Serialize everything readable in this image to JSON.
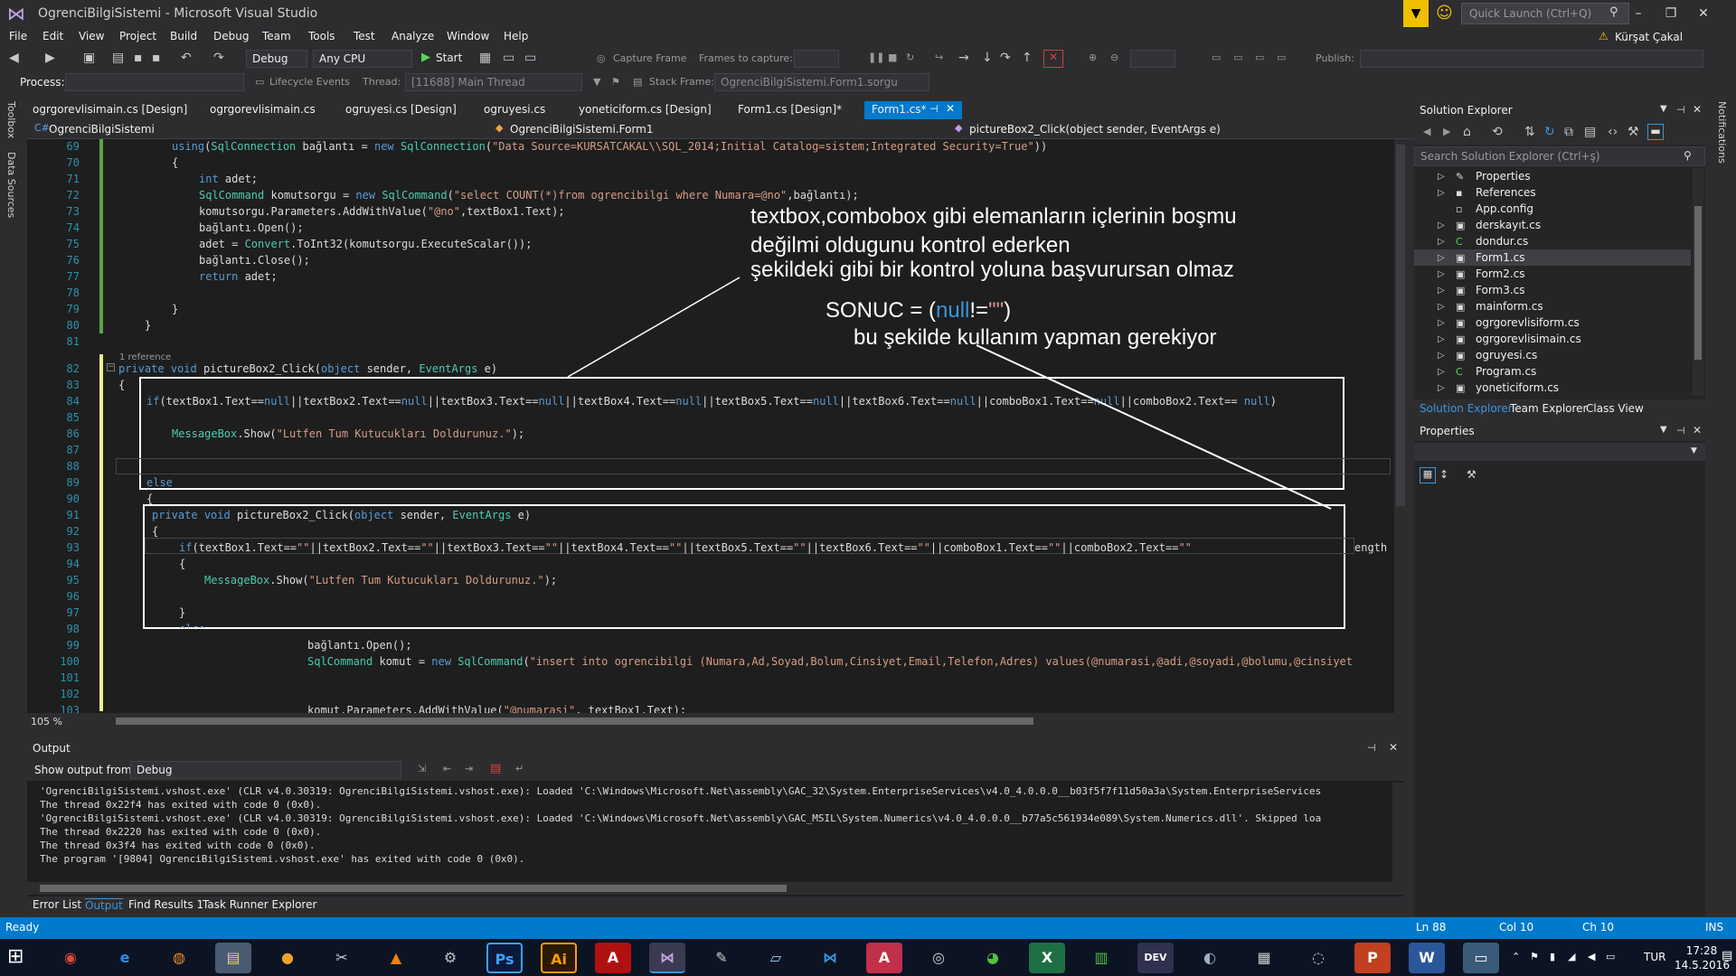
{
  "window": {
    "title": "OgrenciBilgiSistemi - Microsoft Visual Studio",
    "quick_launch": "Quick Launch (Ctrl+Q)",
    "user": "Kürşat Çakal"
  },
  "menu": [
    "File",
    "Edit",
    "View",
    "Project",
    "Build",
    "Debug",
    "Team",
    "Tools",
    "Test",
    "Analyze",
    "Window",
    "Help"
  ],
  "toolbar": {
    "config": "Debug",
    "platform": "Any CPU",
    "start": "Start",
    "capture": "Capture Frame",
    "frames_label": "Frames to capture:",
    "publish": "Publish:"
  },
  "toolbar2": {
    "process_label": "Process:",
    "lifecycle": "Lifecycle Events",
    "thread_label": "Thread:",
    "thread_value": "[11688] Main Thread",
    "stack_label": "Stack Frame:",
    "stack_value": "OgrenciBilgiSistemi.Form1.sorgu"
  },
  "side_tabs": [
    "Toolbox",
    "Data Sources"
  ],
  "right_tab": "Notifications",
  "doc_tabs": [
    "ogrgorevlisimain.cs [Design]",
    "ogrgorevlisimain.cs",
    "ogruyesi.cs [Design]",
    "ogruyesi.cs",
    "yoneticiform.cs [Design]",
    "Form1.cs [Design]*",
    "Form1.cs*"
  ],
  "navbar": {
    "project": "OgrenciBilgiSistemi",
    "class": "OgrenciBilgiSistemi.Form1",
    "member": "pictureBox2_Click(object sender, EventArgs e)"
  },
  "line_numbers": [
    "69",
    "70",
    "71",
    "72",
    "73",
    "74",
    "75",
    "76",
    "77",
    "78",
    "79",
    "80",
    "81",
    "82",
    "83",
    "84",
    "85",
    "86",
    "87",
    "88",
    "89",
    "90",
    "91",
    "92",
    "93",
    "94",
    "95",
    "96",
    "97",
    "98",
    "99",
    "100",
    "101",
    "102",
    "103"
  ],
  "code": {
    "l69a": "using",
    "l69b": "(",
    "l69c": "SqlConnection",
    "l69d": " bağlantı = ",
    "l69e": "new",
    "l69f": " ",
    "l69g": "SqlConnection",
    "l69h": "(",
    "l69i": "\"Data Source=KURSATCAKAL\\\\SQL_2014;Initial Catalog=sistem;Integrated Security=True\"",
    "l69j": "))",
    "l70": "{",
    "l71a": "int",
    "l71b": " adet;",
    "l72a": "SqlCommand",
    "l72b": " komutsorgu = ",
    "l72c": "new",
    "l72d": "SqlCommand",
    "l72e": "(",
    "l72f": "\"select COUNT(*)from ogrencibilgi where Numara=@no\"",
    "l72g": ",bağlantı);",
    "l73a": "komutsorgu.Parameters.AddWithValue(",
    "l73b": "\"@no\"",
    "l73c": ",textBox1.Text);",
    "l74": "bağlantı.Open();",
    "l75a": "adet = ",
    "l75b": "Convert",
    "l75c": ".ToInt32(komutsorgu.ExecuteScalar());",
    "l76": "bağlantı.Close();",
    "l77a": "return",
    "l77b": " adet;",
    "l79": "}",
    "l80": "}",
    "ref": "1 reference",
    "l82a": "private",
    "l82b": " ",
    "l82c": "void",
    "l82d": " pictureBox2_Click(",
    "l82e": "object",
    "l82f": " sender, ",
    "l82g": "EventArgs",
    "l82h": " e)",
    "l83": "{",
    "l84a": "if",
    "l84b": "(textBox1.Text==",
    "l84c": "null",
    "l84d": "||textBox2.Text==",
    "l84e": "null",
    "l84f": "||textBox3.Text==",
    "l84g": "null",
    "l84h": "||textBox4.Text==",
    "l84i": "null",
    "l84j": "||textBox5.Text==",
    "l84k": "null",
    "l84l": "||textBox6.Text==",
    "l84m": "null",
    "l84n": "||comboBox1.Text==",
    "l84o": "null",
    "l84p": "||comboBox2.Text== ",
    "l84q": "null",
    "l84r": ")",
    "l86a": "MessageBox",
    "l86b": ".Show(",
    "l86c": "\"Lutfen Tum Kutucukları Doldurunuz.\"",
    "l86d": ");",
    "l89": "else",
    "l90": "{",
    "l91a": "private",
    "l91b": " ",
    "l91c": "void",
    "l91d": " pictureBox2_Click(",
    "l91e": "object",
    "l91f": " sender, ",
    "l91g": "EventArgs",
    "l91h": " e)",
    "l92": "{",
    "l93a": "if",
    "l93b": "(textBox1.Text==",
    "l93c": "\"\"",
    "l93d": "||textBox2.Text==",
    "l93e": "\"\"",
    "l93f": "||textBox3.Text==",
    "l93g": "\"\"",
    "l93h": "||textBox4.Text==",
    "l93i": "\"\"",
    "l93j": "||textBox5.Text==",
    "l93k": "\"\"",
    "l93l": "||textBox6.Text==",
    "l93m": "\"\"",
    "l93n": "||comboBox1.Text==",
    "l93o": "\"\"",
    "l93p": "||comboBox2.Text==",
    "l93q": "\"\"",
    "l93tail": "ength",
    "l94": "{",
    "l95a": "MessageBox",
    "l95b": ".Show(",
    "l95c": "\"Lutfen Tum Kutucukları Doldurunuz.\"",
    "l95d": ");",
    "l97": "}",
    "l98": "else",
    "l99": "bağlantı.Open();",
    "l100a": "SqlCommand",
    "l100b": " komut = ",
    "l100c": "new",
    "l100d": "SqlCommand",
    "l100e": "(",
    "l100f": "\"insert into ogrencibilgi (Numara,Ad,Soyad,Bolum,Cinsiyet,Email,Telefon,Adres) values(@numarasi,@adi,@soyadi,@bolumu,@cinsiyet",
    "l103a": "komut.Parameters.AddWithValue(",
    "l103b": "\"@numarasi\"",
    "l103c": ", textBox1.Text);"
  },
  "annotation": {
    "line1": "textbox,combobox gibi elemanların içlerinin boşmu",
    "line2": "değilmi oldugunu kontrol ederken",
    "line3": "şekildeki gibi bir kontrol yoluna başvurursan olmaz",
    "sonuc_a": "SONUC = ",
    "sonuc_b": "(",
    "sonuc_c": "null",
    "sonuc_d": "!=",
    "sonuc_e": "\"\"",
    "sonuc_f": ")",
    "line5": "bu şekilde kullanım yapman gerekiyor"
  },
  "zoom": "105 %",
  "output": {
    "title": "Output",
    "show_from": "Show output from:",
    "source": "Debug",
    "lines": [
      "'OgrenciBilgiSistemi.vshost.exe' (CLR v4.0.30319: OgrenciBilgiSistemi.vshost.exe): Loaded 'C:\\Windows\\Microsoft.Net\\assembly\\GAC_32\\System.EnterpriseServices\\v4.0_4.0.0.0__b03f5f7f11d50a3a\\System.EnterpriseServices",
      "The thread 0x22f4 has exited with code 0 (0x0).",
      "'OgrenciBilgiSistemi.vshost.exe' (CLR v4.0.30319: OgrenciBilgiSistemi.vshost.exe): Loaded 'C:\\Windows\\Microsoft.Net\\assembly\\GAC_MSIL\\System.Numerics\\v4.0_4.0.0.0__b77a5c561934e089\\System.Numerics.dll'. Skipped loa",
      "The thread 0x2220 has exited with code 0 (0x0).",
      "The thread 0x3f4 has exited with code 0 (0x0).",
      "The program '[9804] OgrenciBilgiSistemi.vshost.exe' has exited with code 0 (0x0)."
    ]
  },
  "bottom_tabs": [
    "Error List",
    "Output",
    "Find Results 1",
    "Task Runner Explorer"
  ],
  "solution_explorer": {
    "title": "Solution Explorer",
    "search": "Search Solution Explorer (Ctrl+ş)",
    "items": [
      "Properties",
      "References",
      "App.config",
      "derskayıt.cs",
      "dondur.cs",
      "Form1.cs",
      "Form2.cs",
      "Form3.cs",
      "mainform.cs",
      "ogrgorevlisiform.cs",
      "ogrgorevlisimain.cs",
      "ogruyesi.cs",
      "Program.cs",
      "yoneticiform.cs"
    ],
    "tabs": [
      "Solution Explorer",
      "Team Explorer",
      "Class View"
    ]
  },
  "properties": {
    "title": "Properties"
  },
  "status": {
    "ready": "Ready",
    "ln": "Ln 88",
    "col": "Col 10",
    "ch": "Ch 10",
    "ins": "INS"
  },
  "taskbar": {
    "lang": "TUR",
    "time": "17:28",
    "date": "14.5.2016"
  },
  "colors": {
    "accent": "#007acc",
    "keyword": "#569cd6",
    "type": "#4ec9b0",
    "string": "#d69d85",
    "linenum": "#2b91af"
  }
}
